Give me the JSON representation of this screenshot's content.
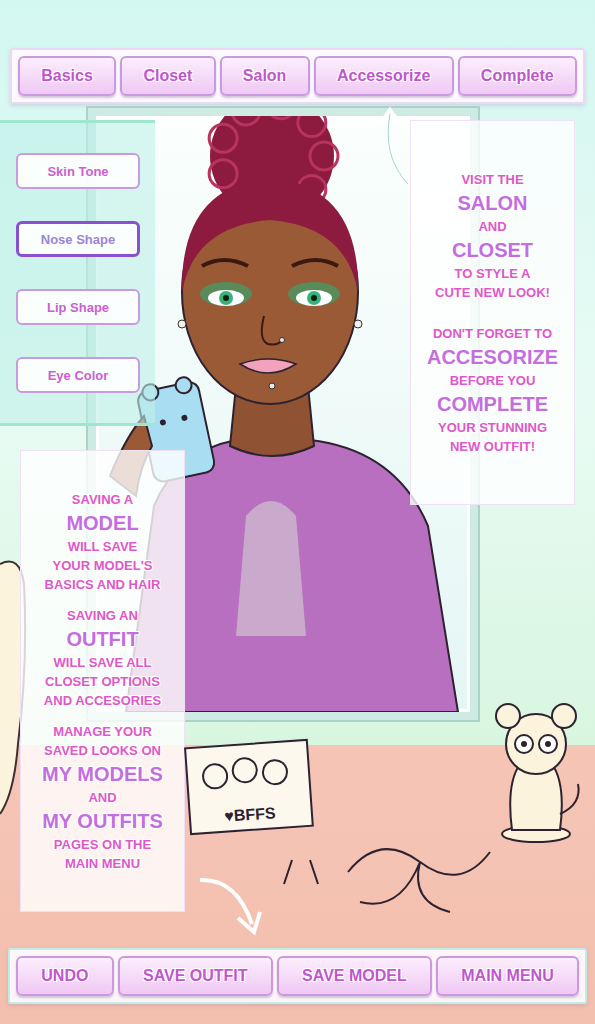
{
  "top_nav": [
    {
      "label": "Basics",
      "selected": false
    },
    {
      "label": "Closet",
      "selected": false
    },
    {
      "label": "Salon",
      "selected": false
    },
    {
      "label": "Accessorize",
      "selected": false
    },
    {
      "label": "Complete",
      "selected": false
    }
  ],
  "basics_menu": [
    {
      "label": "Skin Tone",
      "selected": false
    },
    {
      "label": "Nose Shape",
      "selected": true
    },
    {
      "label": "Lip Shape",
      "selected": false
    },
    {
      "label": "Eye Color",
      "selected": false
    }
  ],
  "tip_panel": {
    "paragraphs": [
      [
        {
          "text": "VISIT THE",
          "kind": "small"
        },
        {
          "text": "SALON",
          "kind": "big"
        },
        {
          "text": "AND",
          "kind": "small"
        },
        {
          "text": "CLOSET",
          "kind": "big"
        },
        {
          "text": "TO STYLE A",
          "kind": "small"
        },
        {
          "text": "CUTE NEW LOOK!",
          "kind": "small"
        }
      ],
      [
        {
          "text": "DON'T FORGET TO",
          "kind": "small"
        },
        {
          "text": "ACCESORIZE",
          "kind": "big"
        },
        {
          "text": "BEFORE YOU",
          "kind": "small"
        },
        {
          "text": "COMPLETE",
          "kind": "big"
        },
        {
          "text": "YOUR STUNNING",
          "kind": "small"
        },
        {
          "text": "NEW OUTFIT!",
          "kind": "small"
        }
      ]
    ]
  },
  "info_panel": {
    "paragraphs": [
      [
        {
          "text": "SAVING A",
          "kind": "small"
        },
        {
          "text": "MODEL",
          "kind": "big"
        },
        {
          "text": "WILL SAVE",
          "kind": "small"
        },
        {
          "text": "YOUR MODEL'S",
          "kind": "small"
        },
        {
          "text": "BASICS AND HAIR",
          "kind": "small"
        }
      ],
      [
        {
          "text": "SAVING AN",
          "kind": "small"
        },
        {
          "text": "OUTFIT",
          "kind": "big"
        },
        {
          "text": "WILL SAVE ALL",
          "kind": "small"
        },
        {
          "text": "CLOSET OPTIONS",
          "kind": "small"
        },
        {
          "text": "AND ACCESORIES",
          "kind": "small"
        }
      ],
      [
        {
          "text": "MANAGE YOUR",
          "kind": "small"
        },
        {
          "text": "SAVED LOOKS ON",
          "kind": "small"
        },
        {
          "text": "MY MODELS",
          "kind": "big"
        },
        {
          "text": "AND",
          "kind": "small"
        },
        {
          "text": "MY OUTFITS",
          "kind": "big"
        },
        {
          "text": "PAGES ON THE",
          "kind": "small"
        },
        {
          "text": "MAIN MENU",
          "kind": "small"
        }
      ]
    ]
  },
  "desk": {
    "photo_caption": "♥BFFS"
  },
  "bottom_bar": [
    "UNDO",
    "SAVE OUTFIT",
    "SAVE MODEL",
    "MAIN MENU"
  ]
}
